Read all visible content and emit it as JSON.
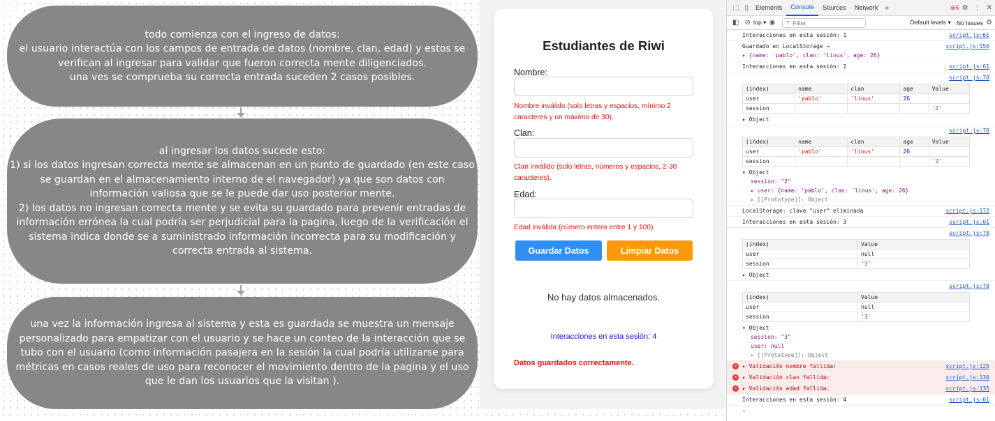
{
  "flow": {
    "box1": "todo comienza con el ingreso de datos:\nel usuario interactúa con los campos de entrada de datos (nombre, clan, edad) y estos se verifican al ingresar para validar que fueron correcta mente diligenciados.\nuna ves se comprueba su correcta entrada suceden 2 casos posibles.",
    "box2": "al ingresar los datos sucede esto:\n1) si los datos ingresan correcta mente se almacenan en un punto de guardado (en este caso se guardan en el almacenamiento interno de el navegador) ya que son datos con información valiosa que se le puede dar uso posterior mente.\n2) los datos no ingresan correcta mente y se evita su guardado para prevenir entradas de información errónea la cual podría ser perjudicial para la pagina, luego de la verificación el sistema indica donde se a suministrado información incorrecta para su modificación y correcta entrada al sistema.",
    "box3": "una vez la información ingresa al sistema y esta es guardada se muestra un mensaje personalizado para empatizar con el usuario y se hace un conteo de la interacción que se tubo con el usuario (como información pasajera en la sesión la cual podría utilizarse para métricas en casos reales de uso para reconocer el movimiento dentro de la pagina y el uso que le dan los usuarios que la visitan )."
  },
  "form": {
    "title": "Estudiantes de Riwi",
    "name_label": "Nombre:",
    "name_error": "Nombre inválido (solo letras y espacios, mínimo 2 caracteres y un máximo de 30).",
    "clan_label": "Clan:",
    "clan_error": "Clan inválido (solo letras, números y espacios, 2-30 caracteres).",
    "age_label": "Edad:",
    "age_error": "Edad inválida (número entero entre 1 y 100).",
    "save_button": "Guardar Datos",
    "clear_button": "Limpiar Datos",
    "no_data": "No hay datos almacenados.",
    "session_count": "Interacciones en esta sesión: 4",
    "saved_message": "Datos guardados correctamente."
  },
  "devtools": {
    "tabs": [
      "Elements",
      "Console",
      "Sources",
      "Network"
    ],
    "active_tab": "Console",
    "error_count": "6",
    "context": "top",
    "filter_placeholder": "Filter",
    "levels": "Default levels",
    "issues": "No Issues",
    "logs": [
      {
        "text": "Interacciones en esta sesión: 1",
        "link": "script.js:61"
      },
      {
        "text": "Guardado en LocalStorage →",
        "detail": "▸ {name: 'pablo', clan: 'linus', age: 26}",
        "link": "script.js:150"
      },
      {
        "text": "Interacciones en esta sesión: 2",
        "link": "script.js:61"
      },
      {
        "text": "LocalStorage: clave \"user\" eliminada",
        "link": "script.js:172"
      },
      {
        "text": "Interacciones en esta sesión: 3",
        "link": "script.js:61"
      },
      {
        "text": "▸ Validación nombre fallida:",
        "link": "script.js:125"
      },
      {
        "text": "▸ Validación clan fallida:",
        "link": "script.js:130"
      },
      {
        "text": "▸ Validación edad fallida:",
        "link": "script.js:135"
      },
      {
        "text": "Interacciones en esta sesión: 4",
        "link": "script.js:61"
      }
    ],
    "table_link": "script.js:78",
    "table_full": {
      "headers": [
        "(index)",
        "name",
        "clan",
        "age",
        "Value"
      ],
      "rows": [
        [
          "user",
          "'pablo'",
          "'linus'",
          "26",
          ""
        ]
      ],
      "session_row_1": [
        "session",
        "",
        "",
        "",
        "'2'"
      ]
    },
    "table_short": {
      "headers": [
        "(index)",
        "Value"
      ],
      "user_row": [
        "user",
        "null"
      ],
      "session_row": [
        "session",
        "'3'"
      ]
    },
    "object_label": "▸ Object",
    "object_expanded": "▾ Object",
    "session_2": "session: \"2\"",
    "user_obj": "▸ user: {name: 'pablo', clan: 'linus', age: 26}",
    "prototype": "▸ [[Prototype]]: Object",
    "session_3": "session: \"3\"",
    "user_null": "user: null"
  }
}
